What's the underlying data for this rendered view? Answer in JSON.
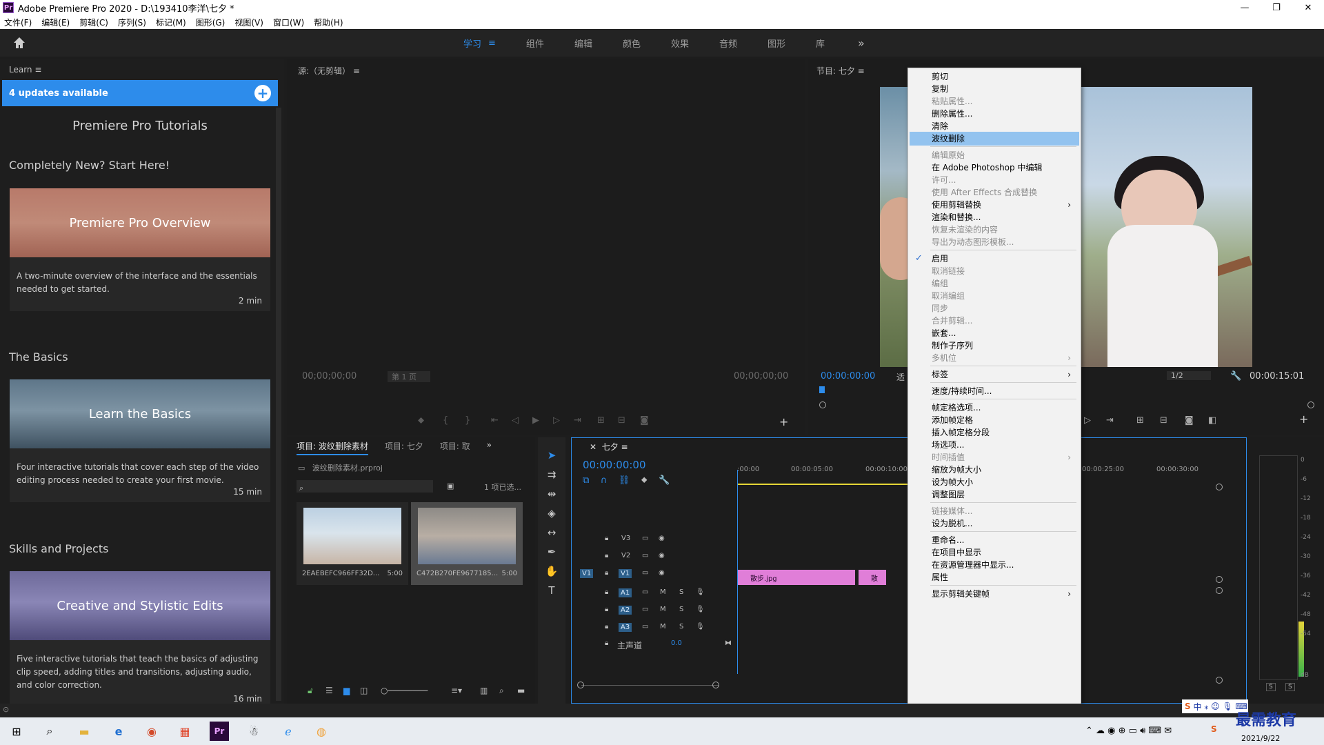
{
  "window": {
    "title": "Adobe Premiere Pro 2020 - D:\\193410李洋\\七夕 *",
    "minimize": "—",
    "restore": "❐",
    "close": "✕"
  },
  "menu": [
    "文件(F)",
    "编辑(E)",
    "剪辑(C)",
    "序列(S)",
    "标记(M)",
    "图形(G)",
    "视图(V)",
    "窗口(W)",
    "帮助(H)"
  ],
  "workspaces": {
    "tabs": [
      "学习",
      "组件",
      "编辑",
      "颜色",
      "效果",
      "音频",
      "图形",
      "库"
    ],
    "active": "学习",
    "menu_icon": "≡",
    "more": "»"
  },
  "learn": {
    "header": "Learn",
    "updates": "4 updates available",
    "title": "Premiere Pro Tutorials",
    "sections": [
      "Completely New? Start Here!",
      "The Basics",
      "Skills and Projects"
    ],
    "cards": [
      {
        "title": "Premiere Pro Overview",
        "desc": "A two-minute overview of the interface and the essentials needed to get started.",
        "duration": "2 min"
      },
      {
        "title": "Learn the Basics",
        "desc": "Four interactive tutorials that cover each step of the video editing process needed to create your first movie.",
        "duration": "15 min"
      },
      {
        "title": "Creative and Stylistic Edits",
        "desc": "Five interactive tutorials that teach the basics of adjusting clip speed, adding titles and transitions, adjusting audio, and color correction.",
        "duration": "16 min"
      }
    ]
  },
  "source": {
    "title": "源:（无剪辑）",
    "tc_left": "00;00;00;00",
    "page": "第 1 页",
    "tc_right": "00;00;00;00"
  },
  "program": {
    "title": "节目: 七夕",
    "tc": "00:00:00:00",
    "fit": "适",
    "res": "1/2",
    "duration": "00:00:15:01"
  },
  "project": {
    "tabs": [
      "项目: 波纹删除素材",
      "项目: 七夕",
      "项目: 取"
    ],
    "file": "波纹删除素材.prproj",
    "selected": "1 项已选...",
    "items": [
      {
        "name": "2EAEBEFC966FF32D...",
        "duration": "5:00"
      },
      {
        "name": "C472B270FE9677185...",
        "duration": "5:00"
      }
    ]
  },
  "timeline": {
    "title": "七夕",
    "tc": "00:00:00:00",
    "ruler": [
      ":00:00",
      "00:00:05:00",
      "00:00:10:00",
      "00:00:25:00",
      "00:00:30:00"
    ],
    "tracks": [
      {
        "name": "V3"
      },
      {
        "name": "V2"
      },
      {
        "name": "V1",
        "src": "V1"
      },
      {
        "name": "A1"
      },
      {
        "name": "A2"
      },
      {
        "name": "A3"
      }
    ],
    "master": "主声道",
    "master_val": "0.0",
    "clips": [
      "散步.jpg",
      "散"
    ]
  },
  "meter": {
    "scale": [
      "0",
      "-6",
      "-12",
      "-18",
      "-24",
      "-30",
      "-36",
      "-42",
      "-48",
      "-54",
      "dB"
    ],
    "solo": [
      "S",
      "S"
    ]
  },
  "context_menu": {
    "groups": [
      [
        {
          "label": "剪切"
        },
        {
          "label": "复制"
        },
        {
          "label": "粘贴属性...",
          "disabled": true
        },
        {
          "label": "删除属性..."
        },
        {
          "label": "清除"
        },
        {
          "label": "波纹删除",
          "highlight": true
        }
      ],
      [
        {
          "label": "编辑原始",
          "disabled": true
        },
        {
          "label": "在 Adobe Photoshop 中编辑"
        },
        {
          "label": "许可...",
          "disabled": true
        },
        {
          "label": "使用 After Effects 合成替换",
          "disabled": true
        },
        {
          "label": "使用剪辑替换",
          "submenu": true
        },
        {
          "label": "渲染和替换..."
        },
        {
          "label": "恢复未渲染的内容",
          "disabled": true
        },
        {
          "label": "导出为动态图形模板...",
          "disabled": true
        }
      ],
      [
        {
          "label": "启用",
          "checked": true
        },
        {
          "label": "取消链接",
          "disabled": true
        },
        {
          "label": "编组",
          "disabled": true
        },
        {
          "label": "取消编组",
          "disabled": true
        },
        {
          "label": "同步",
          "disabled": true
        },
        {
          "label": "合并剪辑...",
          "disabled": true
        },
        {
          "label": "嵌套..."
        },
        {
          "label": "制作子序列"
        },
        {
          "label": "多机位",
          "disabled": true,
          "submenu": true
        }
      ],
      [
        {
          "label": "标签",
          "submenu": true
        }
      ],
      [
        {
          "label": "速度/持续时间..."
        }
      ],
      [
        {
          "label": "帧定格选项..."
        },
        {
          "label": "添加帧定格"
        },
        {
          "label": "插入帧定格分段"
        },
        {
          "label": "场选项..."
        },
        {
          "label": "时间插值",
          "disabled": true,
          "submenu": true
        },
        {
          "label": "缩放为帧大小"
        },
        {
          "label": "设为帧大小"
        },
        {
          "label": "调整图层"
        }
      ],
      [
        {
          "label": "链接媒体...",
          "disabled": true
        },
        {
          "label": "设为脱机..."
        }
      ],
      [
        {
          "label": "重命名..."
        },
        {
          "label": "在项目中显示"
        },
        {
          "label": "在资源管理器中显示..."
        },
        {
          "label": "属性"
        }
      ],
      [
        {
          "label": "显示剪辑关键帧",
          "submenu": true
        }
      ]
    ]
  },
  "taskbar": {
    "date": "2021/9/22",
    "ime": "中",
    "watermark": "最需教育"
  },
  "colors": {
    "accent": "#2d8ceb",
    "clip": "#e07ed8",
    "menu_highlight": "#93c3ef"
  }
}
